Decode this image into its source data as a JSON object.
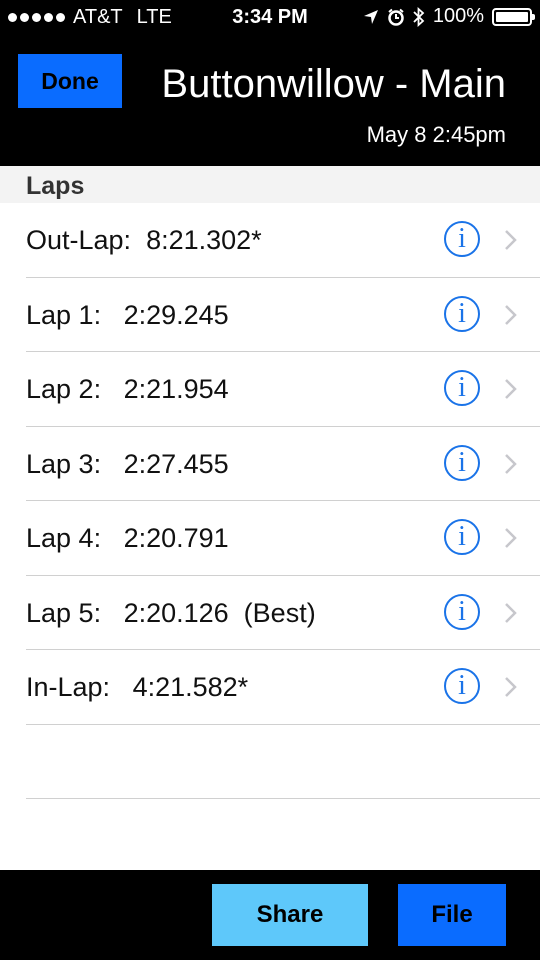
{
  "status_bar": {
    "carrier": "AT&T",
    "network": "LTE",
    "time": "3:34 PM",
    "battery": "100%",
    "battery_level": 1.0
  },
  "header": {
    "done_label": "Done",
    "title": "Buttonwillow - Main",
    "date": "May 8 2:45pm"
  },
  "section": {
    "title": "Laps"
  },
  "laps": [
    {
      "label": "Out-Lap:  8:21.302*"
    },
    {
      "label": "Lap 1:   2:29.245"
    },
    {
      "label": "Lap 2:   2:21.954"
    },
    {
      "label": "Lap 3:   2:27.455"
    },
    {
      "label": "Lap 4:   2:20.791"
    },
    {
      "label": "Lap 5:   2:20.126  (Best)"
    },
    {
      "label": "In-Lap:   4:21.582*"
    }
  ],
  "toolbar": {
    "share_label": "Share",
    "file_label": "File"
  },
  "colors": {
    "accent_blue": "#0a6cff",
    "share_blue": "#5ec8fa",
    "info_blue": "#1a73e8"
  }
}
